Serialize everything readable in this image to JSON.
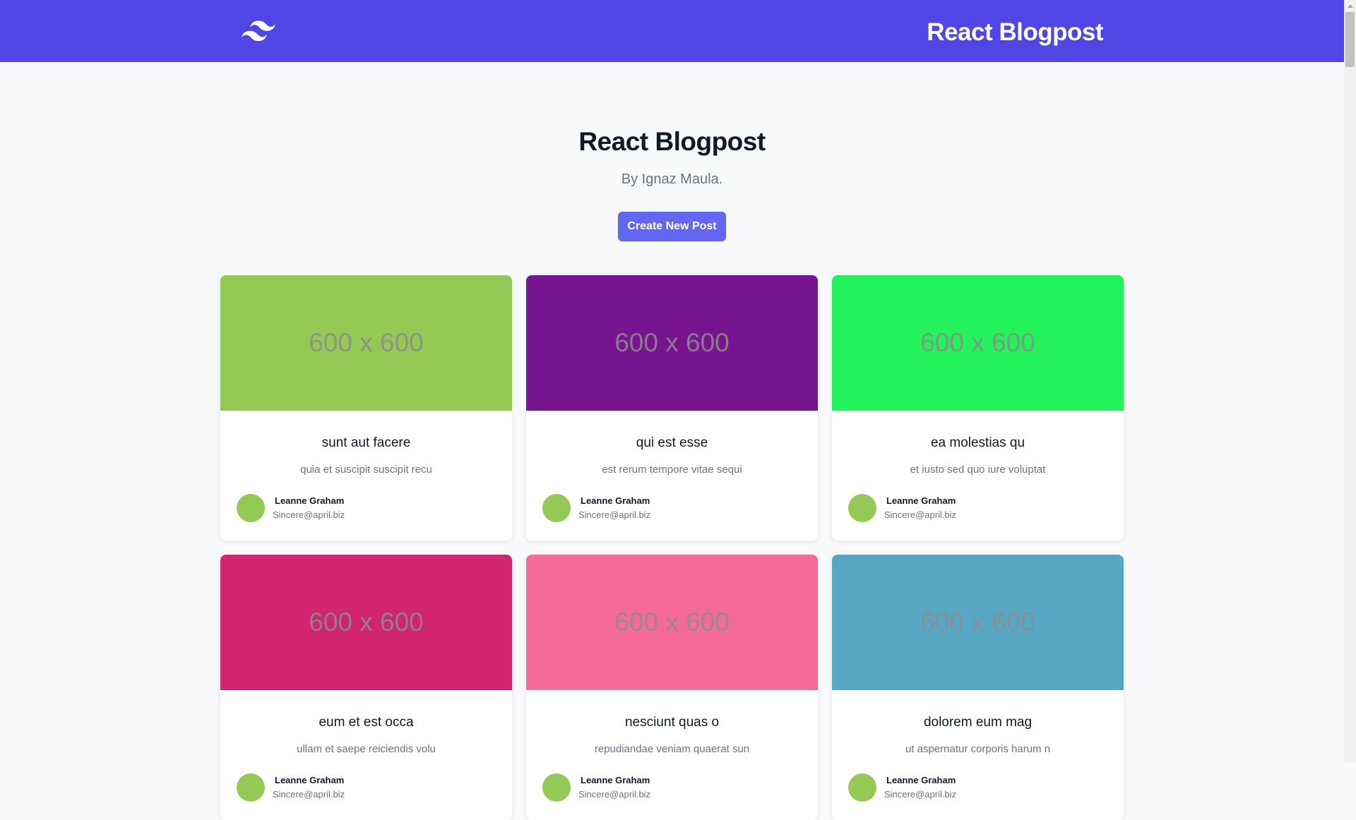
{
  "navbar": {
    "logo_icon": "tailwind-logo-icon",
    "brand": "React Blogpost",
    "bg_color": "#4f46e5"
  },
  "hero": {
    "title": "React Blogpost",
    "subtitle": "By Ignaz Maula.",
    "create_button_label": "Create New Post",
    "button_color": "#6366f1"
  },
  "posts": [
    {
      "image_label": "600 x 600",
      "image_color": "#95c955",
      "title": "sunt aut facere",
      "excerpt": "quia et suscipit suscipit recu",
      "author_name": "Leanne Graham",
      "author_email": "Sincere@april.biz",
      "avatar_color": "#95c955"
    },
    {
      "image_label": "600 x 600",
      "image_color": "#771591",
      "title": "qui est esse",
      "excerpt": "est rerum tempore vitae sequi",
      "author_name": "Leanne Graham",
      "author_email": "Sincere@april.biz",
      "avatar_color": "#95c955"
    },
    {
      "image_label": "600 x 600",
      "image_color": "#24f25a",
      "title": "ea molestias qu",
      "excerpt": "et iusto sed quo iure voluptat",
      "author_name": "Leanne Graham",
      "author_email": "Sincere@april.biz",
      "avatar_color": "#95c955"
    },
    {
      "image_label": "600 x 600",
      "image_color": "#d12473",
      "title": "eum et est occa",
      "excerpt": "ullam et saepe reiciendis volu",
      "author_name": "Leanne Graham",
      "author_email": "Sincere@april.biz",
      "avatar_color": "#95c955"
    },
    {
      "image_label": "600 x 600",
      "image_color": "#f56b97",
      "title": "nesciunt quas o",
      "excerpt": "repudiandae veniam quaerat sun",
      "author_name": "Leanne Graham",
      "author_email": "Sincere@april.biz",
      "avatar_color": "#95c955"
    },
    {
      "image_label": "600 x 600",
      "image_color": "#56a7c4",
      "title": "dolorem eum mag",
      "excerpt": "ut aspernatur corporis harum n",
      "author_name": "Leanne Graham",
      "author_email": "Sincere@april.biz",
      "avatar_color": "#95c955"
    }
  ]
}
